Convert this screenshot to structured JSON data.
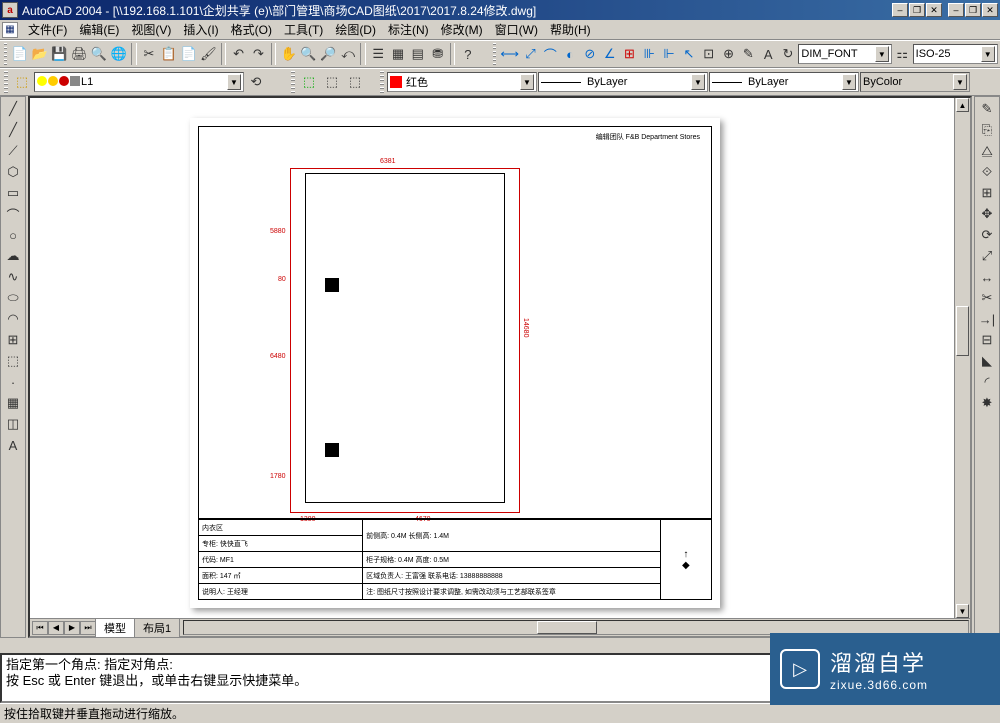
{
  "title": "AutoCAD 2004 - [\\\\192.168.1.101\\企划共享 (e)\\部门管理\\商场CAD图纸\\2017\\2017.8.24修改.dwg]",
  "menus": [
    "文件(F)",
    "编辑(E)",
    "视图(V)",
    "插入(I)",
    "格式(O)",
    "工具(T)",
    "绘图(D)",
    "标注(N)",
    "修改(M)",
    "窗口(W)",
    "帮助(H)"
  ],
  "dim_style_combo": "DIM_FONT",
  "iso_combo": "ISO-25",
  "layer_combo": "L1",
  "color_combo": "红色",
  "linetype_combo": "ByLayer",
  "lineweight_combo": "ByLayer",
  "plotstyle_combo": "ByColor",
  "tabs": {
    "model": "模型",
    "layout1": "布局1"
  },
  "cmd_lines": [
    "指定第一个角点: 指定对角点:",
    "按 Esc 或 Enter 键退出，或单击右键显示快捷菜单。"
  ],
  "status_text": "按住拾取键并垂直拖动进行缩放。",
  "watermark": {
    "brand": "溜溜自学",
    "url": "zixue.3d66.com"
  },
  "drawing": {
    "header_text": "编辑团队  F&B Department Stores",
    "dim_top": "6381",
    "dim_left1": "5880",
    "dim_left2": "80",
    "dim_left3": "6480",
    "dim_left4": "1780",
    "dim_right": "14680",
    "dim_bot1": "1380",
    "dim_bot2": "4670",
    "tb_r1c1": "内衣区",
    "tb_r2c1": "专柜: 快快直飞",
    "tb_r2c2": "前侧高: 0.4M    长侧高: 1.4M",
    "tb_r3c1": "代码: MF1",
    "tb_r3c2": "柜子规格: 0.4M    高度: 0.5M",
    "tb_r4c1": "面积: 147 ㎡",
    "tb_r4c2": "区域负责人: 王富强   联系电话: 13888888888",
    "tb_r5": "注: 图纸尺寸按照设计要求调整, 如需改动须与工艺部联系签章",
    "tb_r6": "说明人: 王经理"
  }
}
